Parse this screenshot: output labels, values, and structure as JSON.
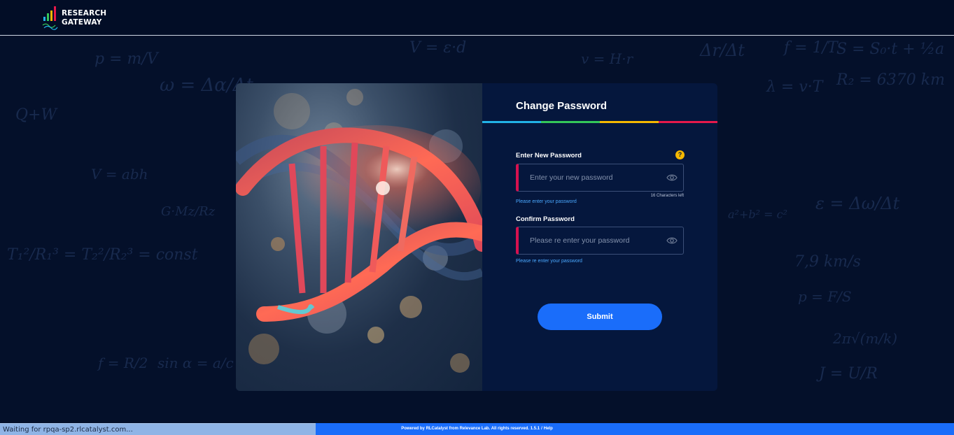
{
  "header": {
    "logo_line1": "RESEARCH",
    "logo_line2": "GATEWAY",
    "bar_colors": [
      "#22b2e6",
      "#34c759",
      "#f5b800",
      "#e6194b"
    ]
  },
  "background_formulas": [
    "p = m/V",
    "V = ε·d",
    "v = H·r",
    "Δr/Δt",
    "f = 1/T",
    "S = S₀·t + ½a",
    "λ = v·T",
    "R₂ = 6370 km",
    "ω = Δα/Δt",
    "a²+b² = c²",
    "ε = Δω/Δt",
    "V = abh",
    "T₁²/R₁³ = T₂²/R₂³ = const",
    "sin α = a/c",
    "f = R/2",
    "J = U/R",
    "2π√(m/k)",
    "p = F/S",
    "7,9 km/s",
    "Q+W",
    "G·Mz/Rz"
  ],
  "card": {
    "title": "Change Password",
    "title_rule_colors": [
      "#22b2e6",
      "#34c759",
      "#f5b800",
      "#e6194b"
    ],
    "new_password": {
      "label": "Enter New Password",
      "placeholder": "Enter your new password",
      "value": "",
      "counter": "16 Characters left",
      "hint": "Please enter your password",
      "help_icon": "question-icon"
    },
    "confirm_password": {
      "label": "Confirm Password",
      "placeholder": "Please re enter your password",
      "value": "",
      "hint": "Please re enter your password"
    },
    "submit_label": "Submit",
    "accent_invalid": "#d6114f",
    "hint_color": "#4aa8ff",
    "submit_color": "#1a6dfa"
  },
  "footer": {
    "text": "Powered by RLCatalyst from Relevance Lab. All rights reserved. 1.5.1",
    "separator": "/",
    "help_link": "Help"
  },
  "browser_status": "Waiting for rpqa-sp2.rlcatalyst.com..."
}
